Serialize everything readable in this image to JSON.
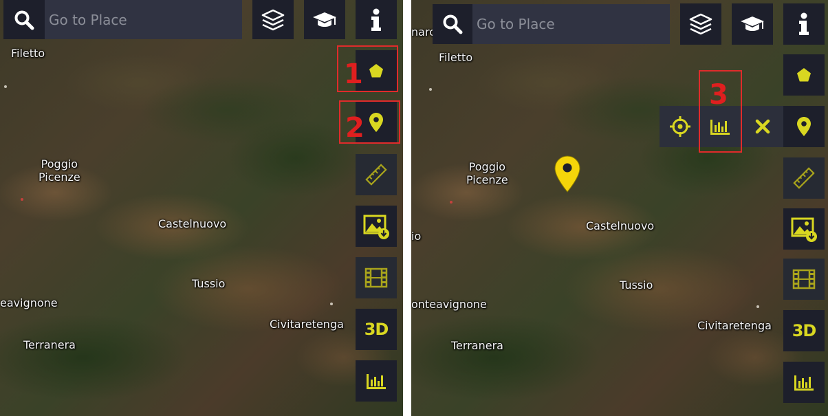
{
  "search": {
    "placeholder": "Go to Place",
    "value": ""
  },
  "colors": {
    "accent": "#d9d721",
    "button_bg": "#1d1f2b",
    "annotation": "#e02b2b",
    "pin": "#f5d50a"
  },
  "icons": {
    "search": "search-icon",
    "layers": "layers-icon",
    "education": "graduation-cap-icon",
    "info": "info-icon",
    "polygon": "pentagon-icon",
    "marker": "map-pin-icon",
    "measure": "ruler-icon",
    "download_image": "image-download-icon",
    "timelapse": "film-icon",
    "three_d": "3d-icon",
    "chart": "bar-chart-icon",
    "locate": "crosshair-icon",
    "close": "close-icon"
  },
  "toolbar": {
    "three_d_label": "3D"
  },
  "annotations": {
    "one": "1",
    "two": "2",
    "three": "3"
  },
  "left_map": {
    "towns": {
      "filetto": "Filetto",
      "poggio": "Poggio\nPicenze",
      "castelnuovo": "Castelnuovo",
      "tussio": "Tussio",
      "avignone": "eavignone",
      "civitaretenga": "Civitaretenga",
      "terranera": "Terranera"
    }
  },
  "right_map": {
    "towns": {
      "marc": "narc",
      "filetto": "Filetto",
      "poggio": "Poggio\nPicenze",
      "castelnuovo": "Castelnuovo",
      "io": "io",
      "tussio": "Tussio",
      "avignone": "onteavignone",
      "civitaretenga": "Civitaretenga",
      "terranera": "Terranera"
    }
  }
}
